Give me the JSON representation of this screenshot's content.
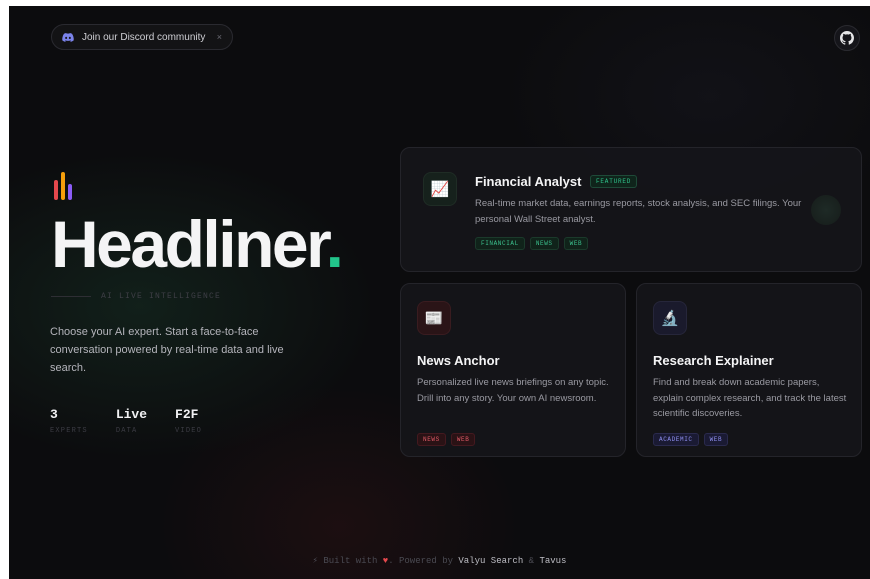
{
  "banner": {
    "discord_label": "Join our Discord community",
    "close_glyph": "×",
    "discord_icon": "discord-icon"
  },
  "header": {
    "github_icon": "github-icon"
  },
  "hero": {
    "title": "Headliner",
    "title_dot": ".",
    "tagline": "AI LIVE INTELLIGENCE",
    "intro": "Choose your AI expert. Start a face-to-face conversation powered by real-time data and live search.",
    "bar_colors": [
      "#e5484d",
      "#f59e0b",
      "#8b5cf6"
    ],
    "accent_color": "#22c58b"
  },
  "stats": [
    {
      "value": "3",
      "label": "EXPERTS"
    },
    {
      "value": "Live",
      "label": "DATA"
    },
    {
      "value": "F2F",
      "label": "VIDEO"
    }
  ],
  "experts": {
    "financial": {
      "title": "Financial Analyst",
      "badge": "FEATURED",
      "icon": "📈",
      "description": "Real-time market data, earnings reports, stock analysis, and SEC filings. Your personal Wall Street analyst.",
      "tags": [
        "FINANCIAL",
        "NEWS",
        "WEB"
      ]
    },
    "news": {
      "title": "News Anchor",
      "icon": "📰",
      "description": "Personalized live news briefings on any topic. Drill into any story. Your own AI newsroom.",
      "tags": [
        "NEWS",
        "WEB"
      ]
    },
    "research": {
      "title": "Research Explainer",
      "icon": "🔬",
      "description": "Find and break down academic papers, explain complex research, and track the latest scientific discoveries.",
      "tags": [
        "ACADEMIC",
        "WEB"
      ]
    }
  },
  "footer": {
    "prefix": "⚡ Built with",
    "heart": "♥",
    "middle": ". Powered by",
    "brand1": "Valyu Search",
    "amp": "&",
    "brand2": "Tavus"
  }
}
